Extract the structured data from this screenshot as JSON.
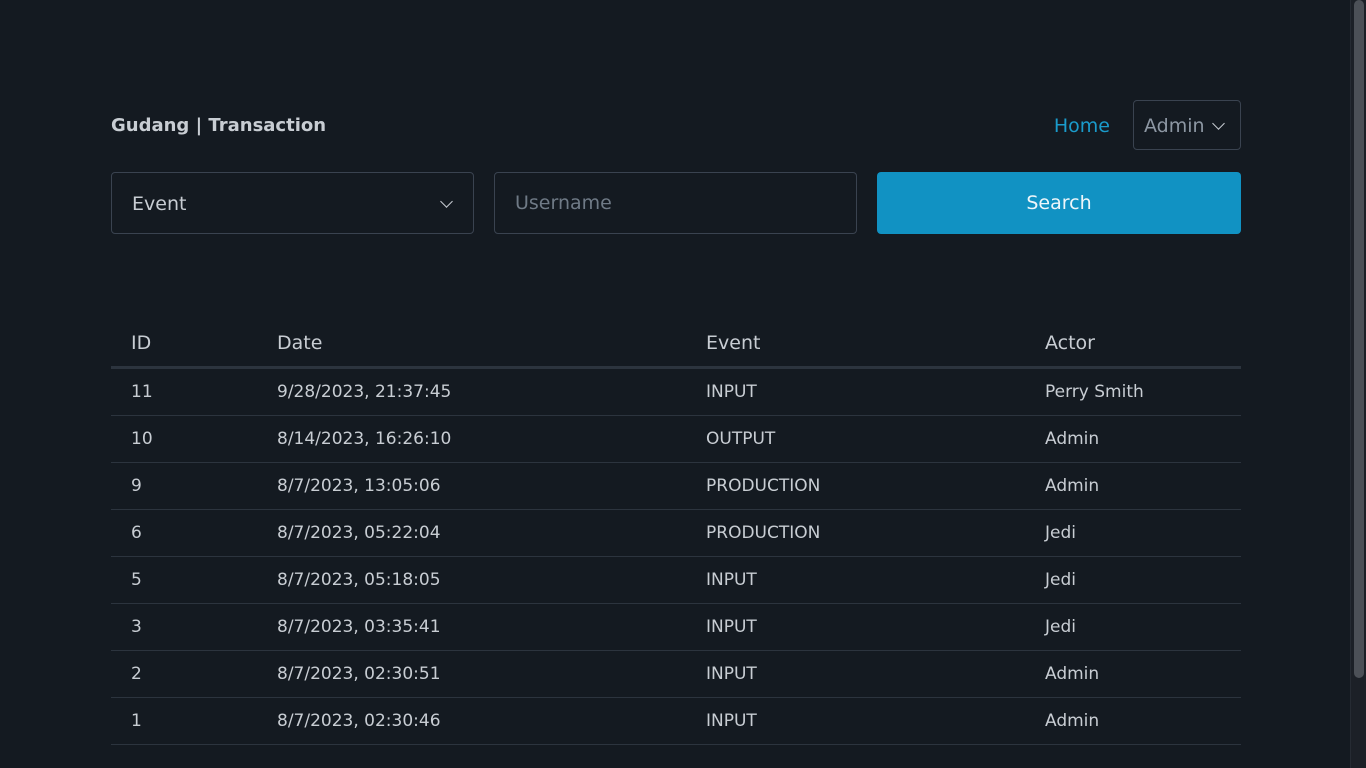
{
  "header": {
    "brand": "Gudang | Transaction",
    "home_link": "Home",
    "role_select": "Admin"
  },
  "filters": {
    "event_select": "Event",
    "username_placeholder": "Username",
    "search_label": "Search"
  },
  "table": {
    "columns": [
      "ID",
      "Date",
      "Event",
      "Actor"
    ],
    "rows": [
      {
        "id": "11",
        "date": "9/28/2023, 21:37:45",
        "event": "INPUT",
        "actor": "Perry Smith"
      },
      {
        "id": "10",
        "date": "8/14/2023, 16:26:10",
        "event": "OUTPUT",
        "actor": "Admin"
      },
      {
        "id": "9",
        "date": "8/7/2023, 13:05:06",
        "event": "PRODUCTION",
        "actor": "Admin"
      },
      {
        "id": "6",
        "date": "8/7/2023, 05:22:04",
        "event": "PRODUCTION",
        "actor": "Jedi"
      },
      {
        "id": "5",
        "date": "8/7/2023, 05:18:05",
        "event": "INPUT",
        "actor": "Jedi"
      },
      {
        "id": "3",
        "date": "8/7/2023, 03:35:41",
        "event": "INPUT",
        "actor": "Jedi"
      },
      {
        "id": "2",
        "date": "8/7/2023, 02:30:51",
        "event": "INPUT",
        "actor": "Admin"
      },
      {
        "id": "1",
        "date": "8/7/2023, 02:30:46",
        "event": "INPUT",
        "actor": "Admin"
      }
    ]
  },
  "colors": {
    "background": "#141a21",
    "accent": "#1192c3",
    "link": "#1a9bcb",
    "text": "#c8cdd3"
  }
}
